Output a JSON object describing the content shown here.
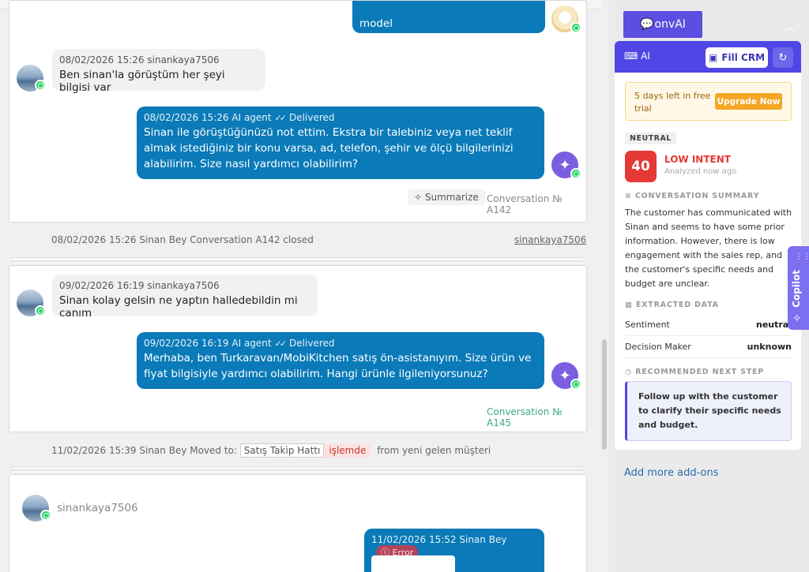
{
  "conversation_1": {
    "top_message_text": "model",
    "incoming": {
      "meta": "08/02/2026 15:26 sinankaya7506",
      "text": "Ben sinan'la görüştüm her şeyi bilgisi var"
    },
    "outgoing": {
      "meta": "08/02/2026 15:26 AI agent",
      "status": "Delivered",
      "text": "Sinan ile görüştüğünüzü not ettim. Ekstra bir talebiniz veya net teklif almak istediğiniz bir konu varsa, ad, telefon, şehir ve ölçü bilgilerinizi alabilirim. Size nasıl yardımcı olabilirim?"
    },
    "summarize_label": "Summarize",
    "conversation_no": "Conversation № A142"
  },
  "event_closed": {
    "text": "08/02/2026 15:26 Sinan Bey Conversation A142 closed",
    "user": "sinankaya7506"
  },
  "conversation_2": {
    "incoming": {
      "meta": "09/02/2026 16:19 sinankaya7506",
      "text": "Sinan kolay gelsin ne yaptın halledebildin mi canım"
    },
    "outgoing": {
      "meta": "09/02/2026 16:19 AI agent",
      "status": "Delivered",
      "text": "Merhaba, ben Turkaravan/MobiKitchen satış ön-asistanıyım. Size ürün ve fiyat bilgisiyle yardımcı olabilirim. Hangi ürünle ilgileniyorsunuz?"
    },
    "conversation_no": "Conversation № A145"
  },
  "event_moved": {
    "prefix": "11/02/2026 15:39 Sinan Bey Moved to:",
    "pipeline": "Satış Takip Hattı",
    "stage": "işlemde",
    "suffix": "from yeni gelen müşteri"
  },
  "conversation_3": {
    "username": "sinankaya7506",
    "outgoing": {
      "meta": "11/02/2026 15:52 Sinan Bey",
      "status": "Error"
    }
  },
  "sidebar": {
    "tab_label": "onvAI",
    "panel_logo": "AI",
    "fill_crm_label": "Fill CRM",
    "trial_text": "5 days left in free trial",
    "upgrade_label": "Upgrade Now",
    "sentiment_tag": "NEUTRAL",
    "score": "40",
    "intent_label": "LOW INTENT",
    "analyzed": "Analyzed now ago",
    "summary_title": "CONVERSATION SUMMARY",
    "summary_text": "The customer has communicated with Sinan and seems to have some prior information. However, there is low engagement with the sales rep, and the customer's specific needs and budget are unclear.",
    "extracted_title": "EXTRACTED DATA",
    "extracted": [
      {
        "key": "Sentiment",
        "value": "neutral"
      },
      {
        "key": "Decision Maker",
        "value": "unknown"
      }
    ],
    "next_step_title": "RECOMMENDED NEXT STEP",
    "next_step_text": "Follow up with the customer to clarify their specific needs and budget.",
    "add_more": "Add more add-ons"
  },
  "copilot_label": "Copilot",
  "colors": {
    "accent": "#4f46e5",
    "bubble_out": "#0a7ab8",
    "whatsapp": "#25d366",
    "error": "#e53935"
  }
}
